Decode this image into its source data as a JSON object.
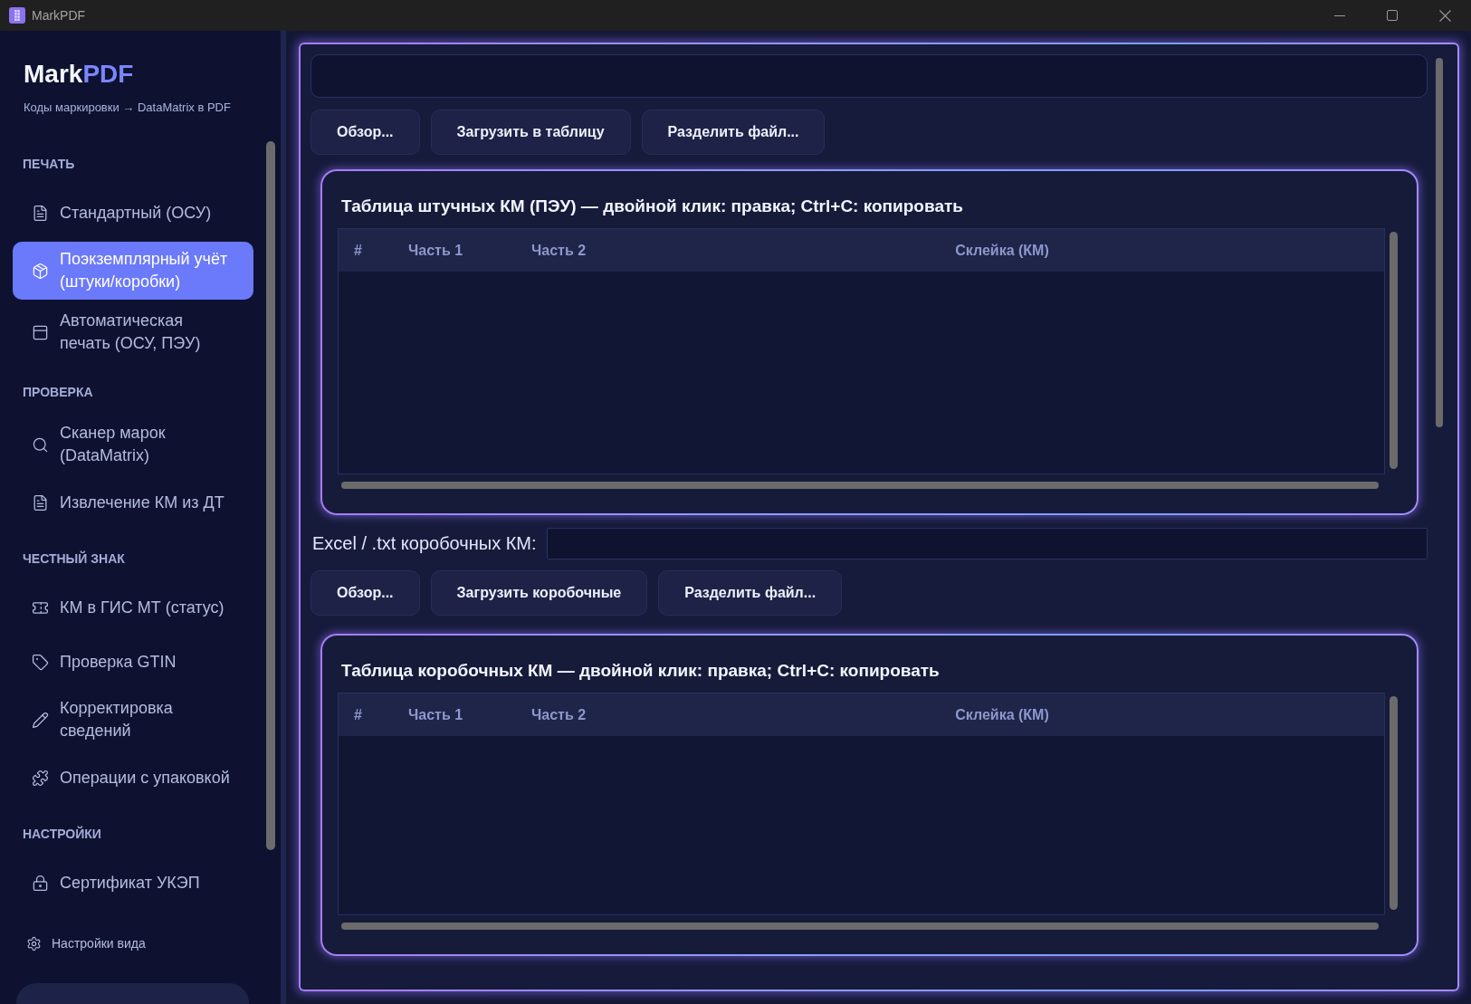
{
  "window": {
    "title": "MarkPDF"
  },
  "sidebar": {
    "brand": {
      "name": "Mark",
      "accent": "PDF"
    },
    "subtitle": "Коды маркировки → DataMatrix в PDF",
    "sections": [
      {
        "title": "ПЕЧАТЬ",
        "items": [
          {
            "label": "Стандартный (ОСУ)",
            "selected": false
          },
          {
            "label": "Поэкземплярный учёт\n(штуки/коробки)",
            "selected": true
          },
          {
            "label": "Автоматическая\nпечать (ОСУ, ПЭУ)",
            "selected": false
          }
        ]
      },
      {
        "title": "ПРОВЕРКА",
        "items": [
          {
            "label": "Сканер марок\n(DataMatrix)",
            "selected": false
          },
          {
            "label": "Извлечение КМ из ДТ",
            "selected": false
          }
        ]
      },
      {
        "title": "ЧЕСТНЫЙ ЗНАК",
        "items": [
          {
            "label": "КМ в ГИС МТ (статус)",
            "selected": false
          },
          {
            "label": "Проверка GTIN",
            "selected": false
          },
          {
            "label": "Корректировка\nсведений",
            "selected": false
          },
          {
            "label": "Операции с упаковкой",
            "selected": false
          }
        ]
      },
      {
        "title": "НАСТРОЙКИ",
        "items": [
          {
            "label": "Сертификат УКЭП",
            "selected": false
          }
        ]
      }
    ],
    "footer_link": "Настройки вида"
  },
  "main": {
    "file_buttons": [
      "Обзор...",
      "Загрузить в таблицу",
      "Разделить файл..."
    ],
    "unit_table": {
      "title": "Таблица штучных КМ (ПЭУ) — двойной клик: правка; Ctrl+C: копировать",
      "columns": [
        "#",
        "Часть 1",
        "Часть 2",
        "Склейка (КМ)"
      ]
    },
    "box_file": {
      "label": "Excel / .txt коробочных КМ:",
      "buttons": [
        "Обзор...",
        "Загрузить коробочные",
        "Разделить файл..."
      ]
    },
    "box_table": {
      "title": "Таблица коробочных КМ — двойной клик: правка; Ctrl+C: копировать",
      "columns": [
        "#",
        "Часть 1",
        "Часть 2",
        "Склейка (КМ)"
      ]
    }
  }
}
